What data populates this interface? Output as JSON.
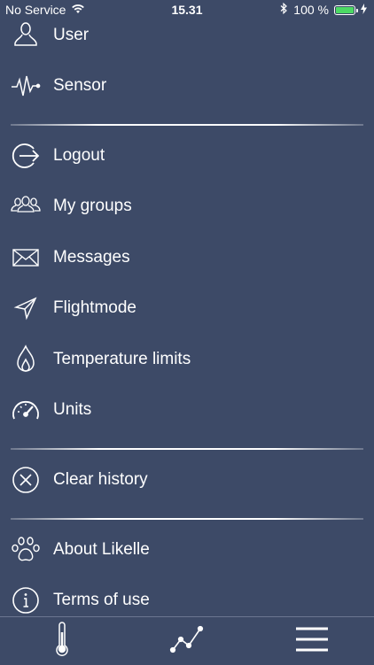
{
  "status_bar": {
    "carrier": "No Service",
    "time": "15.31",
    "battery_percent": "100 %",
    "battery_level": 1.0,
    "battery_color": "#4cd964"
  },
  "menu": {
    "items": [
      {
        "label": "User",
        "icon": "user-icon"
      },
      {
        "label": "Sensor",
        "icon": "pulse-icon"
      },
      {
        "label": "Logout",
        "icon": "logout-icon"
      },
      {
        "label": "My groups",
        "icon": "group-icon"
      },
      {
        "label": "Messages",
        "icon": "envelope-icon"
      },
      {
        "label": "Flightmode",
        "icon": "paper-plane-icon"
      },
      {
        "label": "Temperature limits",
        "icon": "flame-icon"
      },
      {
        "label": "Units",
        "icon": "speedometer-icon"
      },
      {
        "label": "Clear history",
        "icon": "clear-circle-icon"
      },
      {
        "label": "About Likelle",
        "icon": "paw-icon"
      },
      {
        "label": "Terms of use",
        "icon": "info-icon"
      }
    ]
  },
  "tab_bar": {
    "tabs": [
      {
        "icon": "thermometer-icon"
      },
      {
        "icon": "graph-icon"
      },
      {
        "icon": "hamburger-menu-icon"
      }
    ]
  },
  "colors": {
    "background": "#3d4a67",
    "text": "#ffffff"
  }
}
